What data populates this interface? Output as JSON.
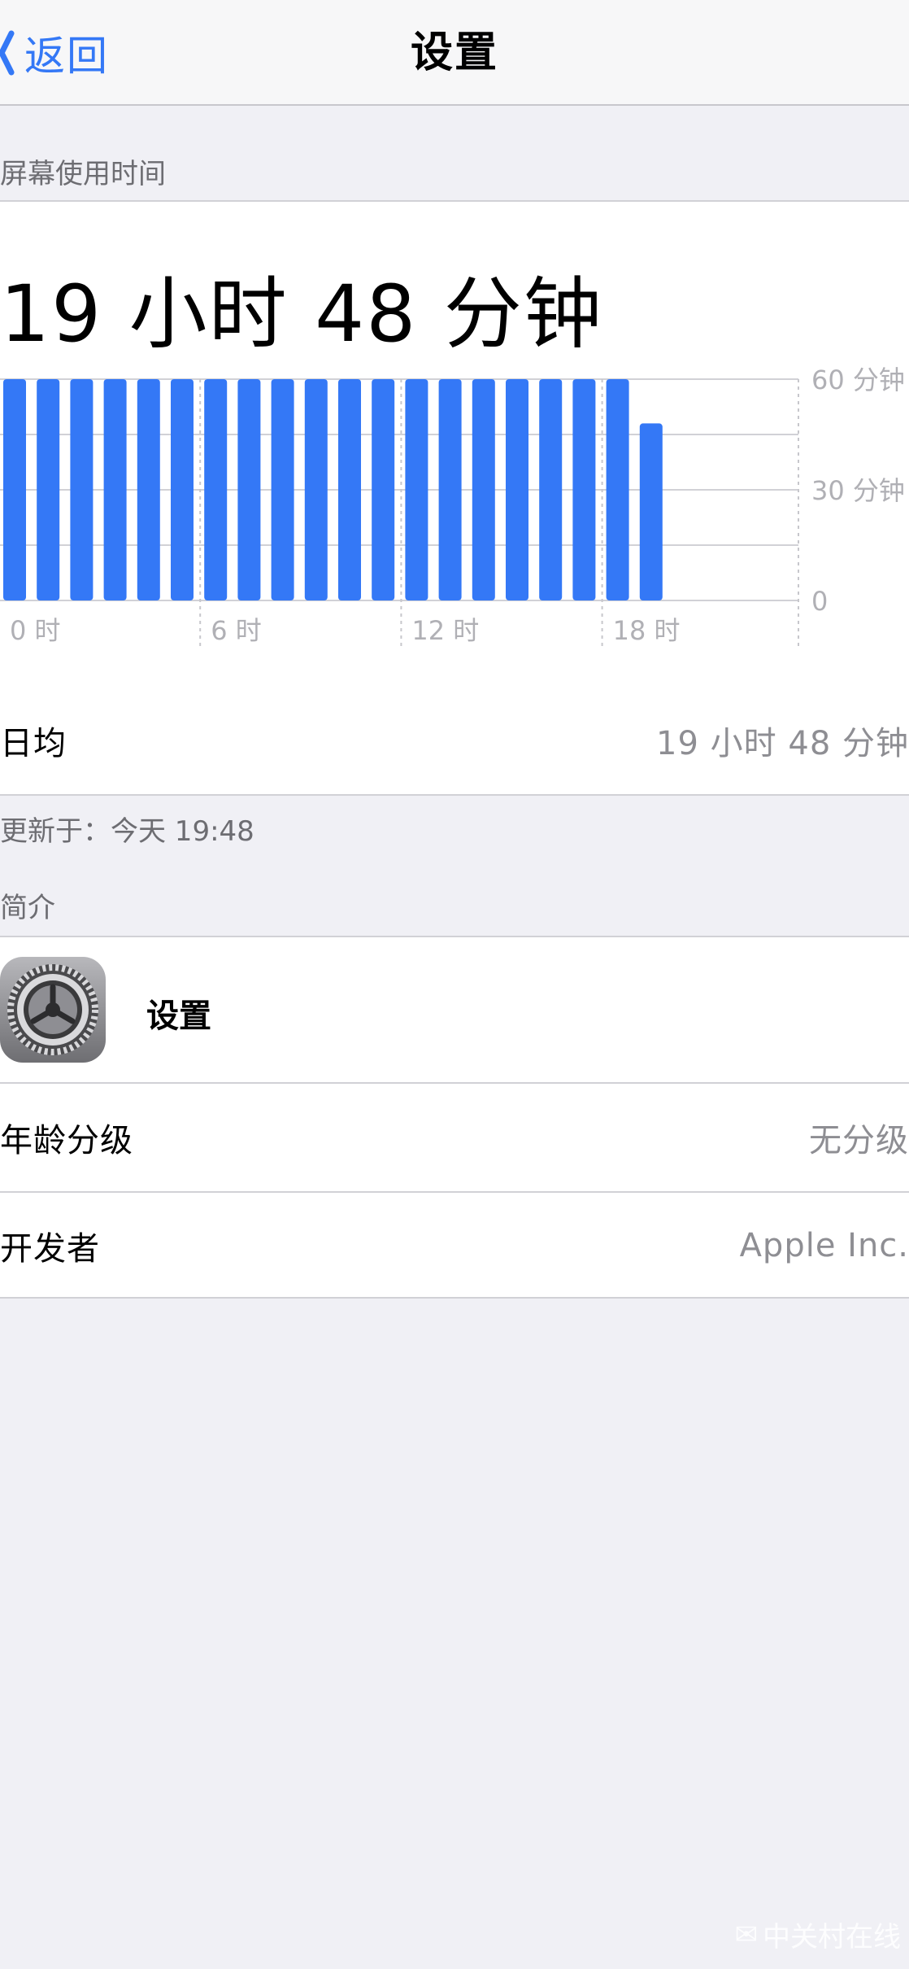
{
  "navbar": {
    "back_label": "返回",
    "title": "设置"
  },
  "screen_time": {
    "section_header": "屏幕使用时间",
    "total": "19 小时 48 分钟",
    "average_label": "日均",
    "average_value": "19 小时 48 分钟",
    "updated": "更新于：今天 19:48"
  },
  "chart_data": {
    "type": "bar",
    "categories": [
      "0",
      "1",
      "2",
      "3",
      "4",
      "5",
      "6",
      "7",
      "8",
      "9",
      "10",
      "11",
      "12",
      "13",
      "14",
      "15",
      "16",
      "17",
      "18",
      "19"
    ],
    "values": [
      60,
      60,
      60,
      60,
      60,
      60,
      60,
      60,
      60,
      60,
      60,
      60,
      60,
      60,
      60,
      60,
      60,
      60,
      60,
      48
    ],
    "x_tick_labels": [
      "0 时",
      "6 时",
      "12 时",
      "18 时"
    ],
    "y_tick_labels": [
      "60 分钟",
      "30 分钟",
      "0"
    ],
    "ylim": [
      0,
      60
    ],
    "bar_color": "#3478f6"
  },
  "profile": {
    "section_header": "简介",
    "app_name": "设置",
    "app_icon": "settings-gear-icon",
    "rating_label": "年龄分级",
    "rating_value": "无分级",
    "developer_label": "开发者",
    "developer_value": "Apple Inc."
  },
  "watermark": "中关村在线",
  "colors": {
    "accent": "#3478f6",
    "background": "#f0f0f5",
    "secondary_text": "#8e8e93"
  }
}
